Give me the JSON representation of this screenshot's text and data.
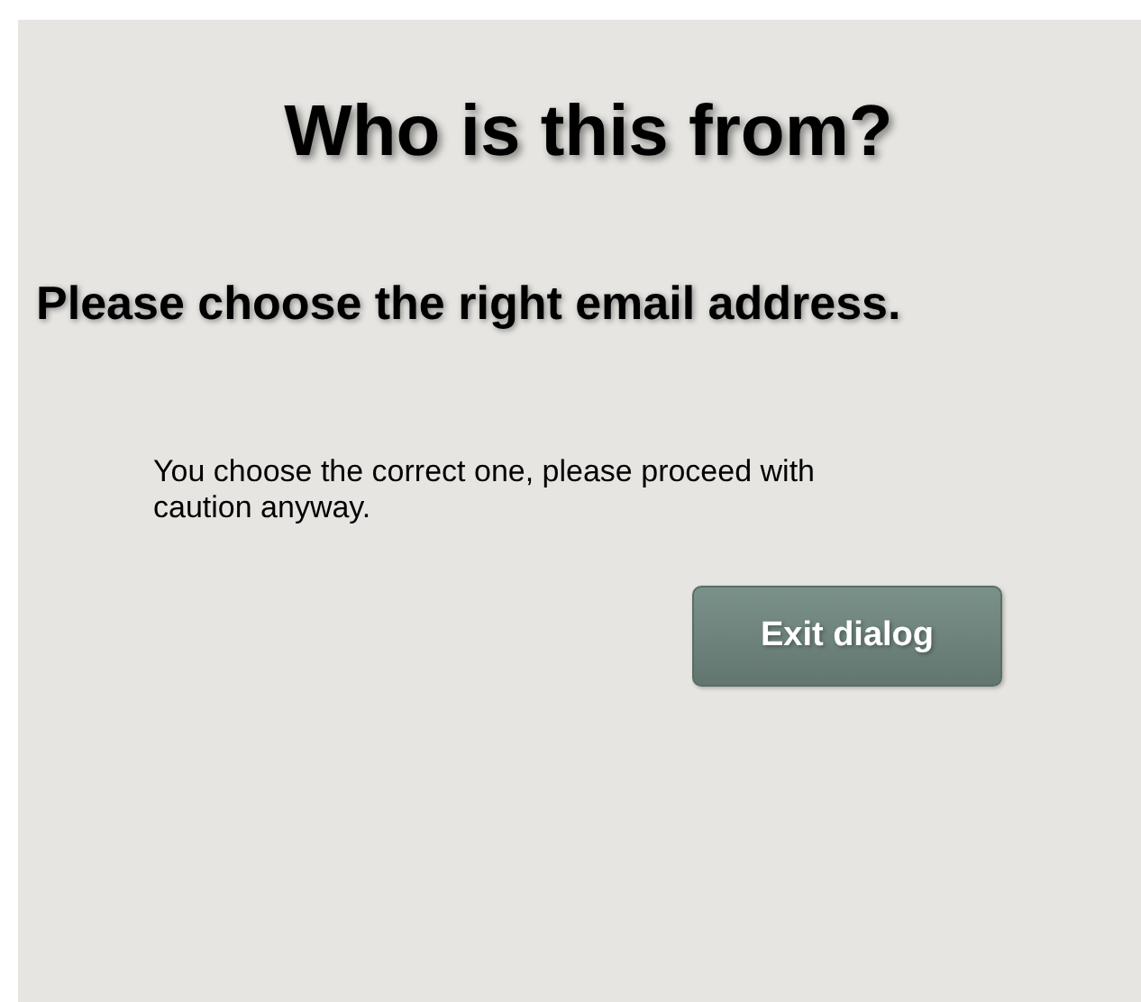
{
  "title": "Who is this from?",
  "subtitle": "Please choose the right email address.",
  "message": "You choose the correct one, please proceed with caution anyway.",
  "buttons": [
    "Exit dialog"
  ]
}
